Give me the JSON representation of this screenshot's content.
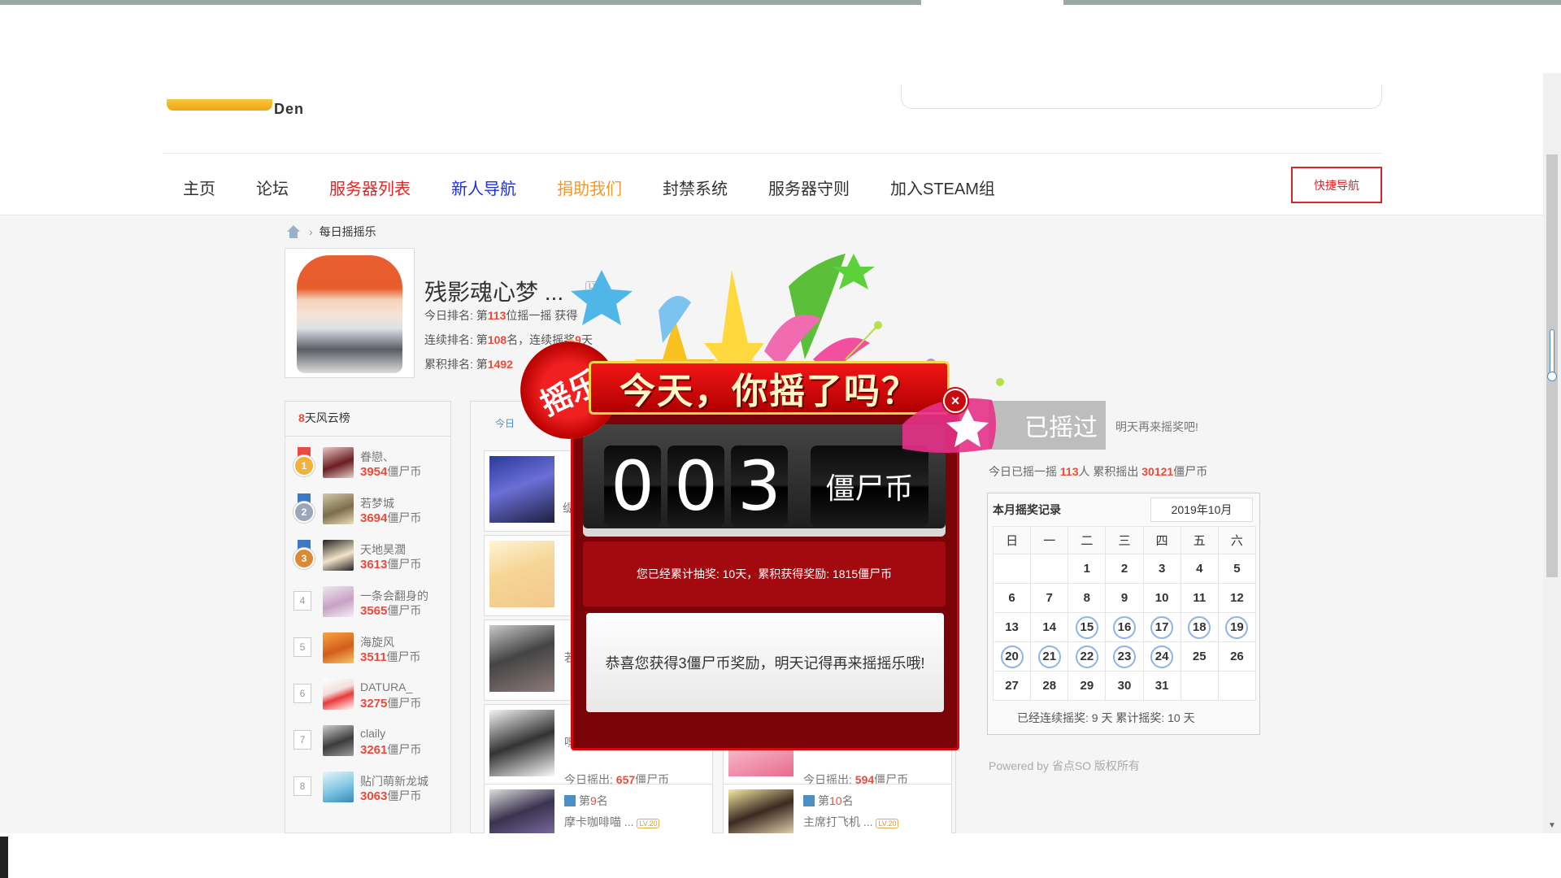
{
  "nav": {
    "items": [
      {
        "label": "主页",
        "color": "#333333"
      },
      {
        "label": "论坛",
        "color": "#333333"
      },
      {
        "label": "服务器列表",
        "color": "#e02626"
      },
      {
        "label": "新人导航",
        "color": "#1d30d6"
      },
      {
        "label": "捐助我们",
        "color": "#f19a2b"
      },
      {
        "label": "封禁系统",
        "color": "#333333"
      },
      {
        "label": "服务器守则",
        "color": "#333333"
      },
      {
        "label": "加入STEAM组",
        "color": "#333333"
      }
    ],
    "quick_nav": "快捷导航"
  },
  "logo": {
    "text": "Den"
  },
  "breadcrumb": {
    "current": "每日摇摇乐"
  },
  "profile": {
    "name": "残影魂心梦 ...",
    "level": "LV.0",
    "today_rank_prefix": "今日排名: 第",
    "today_rank": "113",
    "today_rank_suffix": "位摇一摇 获得",
    "streak_prefix": "连续排名: 第",
    "streak_rank": "108",
    "streak_suffix": "名，连续摇奖",
    "streak_days": "9",
    "streak_tail": "天",
    "total_prefix": "累积排名: 第",
    "total_rank": "1492"
  },
  "leaderboard": {
    "title_num": "8",
    "title_text": "天风云榜",
    "unit": "僵尸币",
    "items": [
      {
        "rank": "1",
        "name": "眷戀、",
        "coins": "3954"
      },
      {
        "rank": "2",
        "name": "若梦城",
        "coins": "3694"
      },
      {
        "rank": "3",
        "name": "天地昊濶",
        "coins": "3613"
      },
      {
        "rank": "4",
        "name": "一条会翻身的",
        "coins": "3565"
      },
      {
        "rank": "5",
        "name": "海旋风",
        "coins": "3511"
      },
      {
        "rank": "6",
        "name": "DATURA_",
        "coins": "3275"
      },
      {
        "rank": "7",
        "name": "claily",
        "coins": "3261"
      },
      {
        "rank": "8",
        "name": "贴门萌新龙城",
        "coins": "3063"
      }
    ]
  },
  "middle": {
    "tab": "今日",
    "cards": [
      {
        "rank_prefix": "第",
        "rank": "9",
        "rank_suffix": "名",
        "name": "摩卡咖啡喵 ...",
        "badge": "LV.20",
        "out_label": "",
        "out_value": ""
      },
      {
        "rank_prefix": "第",
        "rank": "10",
        "rank_suffix": "名",
        "name": "主席打飞机 ...",
        "badge": "LV.20",
        "out_label": "",
        "out_value": ""
      }
    ],
    "out_row": [
      {
        "label": "今日摇出: ",
        "value": "657",
        "unit": "僵尸币"
      },
      {
        "label": "今日摇出: ",
        "value": "594",
        "unit": "僵尸币"
      }
    ],
    "peek_labels": [
      "嘿",
      "若",
      "缇"
    ]
  },
  "shake": {
    "button": "已摇过",
    "hint": "明天再来摇奖吧!",
    "stats_prefix": "今日已摇一摇 ",
    "stats_people": "113",
    "stats_mid": "人 累积摇出 ",
    "stats_total": "30121",
    "stats_unit": "僵尸币"
  },
  "calendar": {
    "title": "本月摇奖记录",
    "month": "2019年10月",
    "weekdays": [
      "日",
      "一",
      "二",
      "三",
      "四",
      "五",
      "六"
    ],
    "weeks": [
      [
        "",
        "",
        "1",
        "2",
        "3",
        "4",
        "5"
      ],
      [
        "6",
        "7",
        "8",
        "9",
        "10",
        "11",
        "12"
      ],
      [
        "13",
        "14",
        "15",
        "16",
        "17",
        "18",
        "19"
      ],
      [
        "20",
        "21",
        "22",
        "23",
        "24",
        "25",
        "26"
      ],
      [
        "27",
        "28",
        "29",
        "30",
        "31",
        "",
        ""
      ]
    ],
    "shaken_days": [
      "15",
      "16",
      "17",
      "18",
      "19",
      "20",
      "21",
      "22",
      "23",
      "24"
    ],
    "footer": "已经连续摇奖:  9 天  累计摇奖:  10 天"
  },
  "powered": "Powered by 省点SO 版权所有",
  "modal": {
    "banner_seal": "摇乐",
    "banner_title": "今天，你摇了吗？",
    "digits": [
      "0",
      "0",
      "3"
    ],
    "coin_label": "僵尸币",
    "stats": "您已经累计抽奖: 10天，累积获得奖励: 1815僵尸币",
    "message": "恭喜您获得3僵尸币奖励，明天记得再来摇摇乐哦!",
    "close": "×"
  },
  "colors": {
    "accent_red": "#e84c3d",
    "modal_red": "#7a0308",
    "calendar_ring": "#8fb3e6"
  }
}
